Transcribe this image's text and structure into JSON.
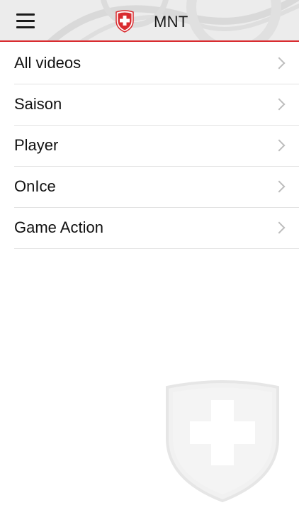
{
  "header": {
    "menu_icon": "hamburger-menu-icon",
    "logo_icon": "swiss-cross-shield-icon",
    "title": "MNT"
  },
  "menu": {
    "items": [
      {
        "label": "All videos"
      },
      {
        "label": "Saison"
      },
      {
        "label": "Player"
      },
      {
        "label": "OnIce"
      },
      {
        "label": "Game Action"
      }
    ],
    "chevron_icon": "chevron-right-icon"
  },
  "watermark": {
    "icon": "swiss-shield-watermark-icon"
  },
  "colors": {
    "accent": "#d92b2f",
    "header_bg": "#ececec",
    "text": "#111111",
    "divider": "#e2e2e2",
    "chevron": "#bdbdbd"
  }
}
